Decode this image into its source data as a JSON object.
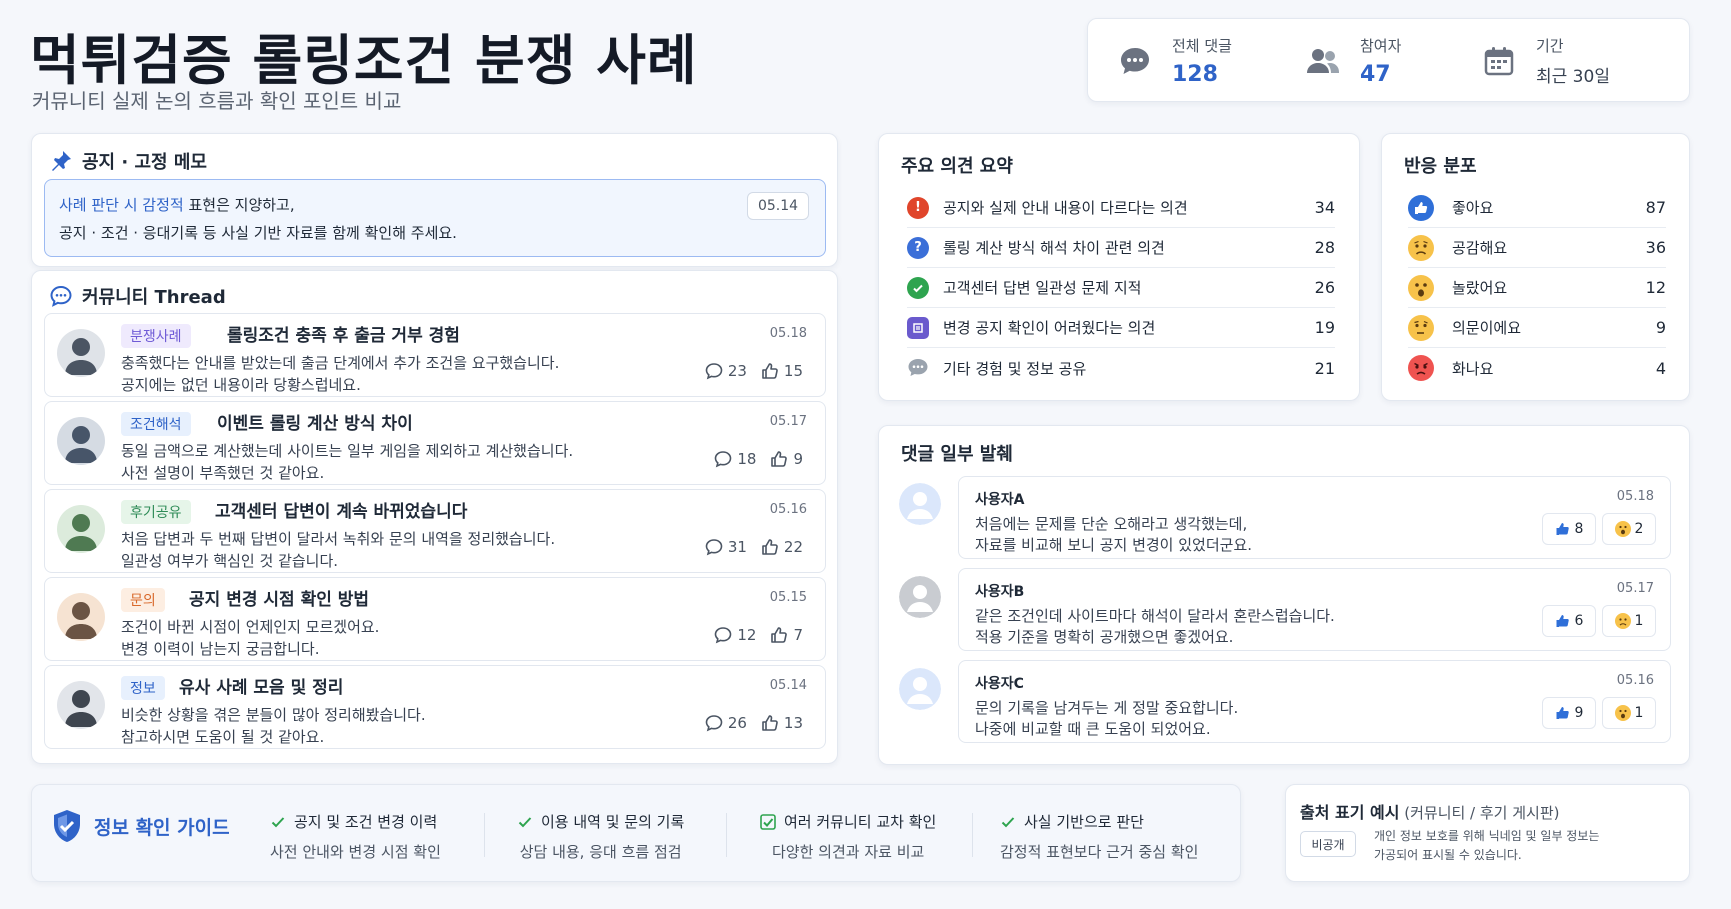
{
  "header": {
    "title": "먹튀검증 롤링조건 분쟁 사례",
    "subtitle": "커뮤니티 실제 논의 흐름과 확인 포인트 비교"
  },
  "stats": [
    {
      "label": "전체 댓글",
      "value": "128",
      "icon": "chat-bubble-icon"
    },
    {
      "label": "참여자",
      "value": "47",
      "icon": "users-icon"
    },
    {
      "label": "기간",
      "value": "최근 30일",
      "icon": "calendar-icon"
    }
  ],
  "notice": {
    "title": "공지 · 고정 메모",
    "line1_highlight": "사례 판단 시 감정적",
    "line1_rest": " 표현은 지양하고,",
    "line2": "공지 · 조건 · 응대기록 등 사실 기반 자료를 함께 확인해 주세요.",
    "date": "05.14"
  },
  "thread": {
    "title": "커뮤니티 Thread",
    "items": [
      {
        "tag": "분쟁사례",
        "title": "롤링조건 충족 후 출금 거부 경험",
        "date": "05.18",
        "line1": "충족했다는 안내를 받았는데 출금 단계에서 추가 조건을 요구했습니다.",
        "line2": "공지에는 없던 내용이라 당황스럽네요.",
        "comments": "23",
        "likes": "15"
      },
      {
        "tag": "조건해석",
        "title": "이벤트 롤링 계산 방식 차이",
        "date": "05.17",
        "line1": "동일 금액으로 계산했는데 사이트는 일부 게임을 제외하고 계산했습니다.",
        "line2": "사전 설명이 부족했던 것 같아요.",
        "comments": "18",
        "likes": "9"
      },
      {
        "tag": "후기공유",
        "title": "고객센터 답변이 계속 바뀌었습니다",
        "date": "05.16",
        "line1": "처음 답변과 두 번째 답변이 달라서 녹취와 문의 내역을 정리했습니다.",
        "line2": "일관성 여부가 핵심인 것 같습니다.",
        "comments": "31",
        "likes": "22"
      },
      {
        "tag": "문의",
        "title": "공지 변경 시점 확인 방법",
        "date": "05.15",
        "line1": "조건이 바뀐 시점이 언제인지 모르겠어요.",
        "line2": "변경 이력이 남는지 궁금합니다.",
        "comments": "12",
        "likes": "7"
      },
      {
        "tag": "정보",
        "title": "유사 사례 모음 및 정리",
        "date": "05.14",
        "line1": "비슷한 상황을 겪은 분들이 많아 정리해봤습니다.",
        "line2": "참고하시면 도움이 될 것 같아요.",
        "comments": "26",
        "likes": "13"
      }
    ]
  },
  "summary": {
    "title": "주요 의견 요약",
    "rows": [
      {
        "label": "공지와 실제 안내 내용이 다르다는 의견",
        "count": "34",
        "icon": "alert-icon",
        "color": "#e0452b"
      },
      {
        "label": "롤링 계산 방식 해석 차이 관련 의견",
        "count": "28",
        "icon": "question-icon",
        "color": "#3b6fd8"
      },
      {
        "label": "고객센터 답변 일관성 문제 지적",
        "count": "26",
        "icon": "check-icon",
        "color": "#2ea44f"
      },
      {
        "label": "변경 공지 확인이 어려웠다는 의견",
        "count": "19",
        "icon": "document-icon",
        "color": "#6a5acd"
      },
      {
        "label": "기타 경험 및 정보 공유",
        "count": "21",
        "icon": "chat-icon",
        "color": "#9aa3ae"
      }
    ]
  },
  "reactions": {
    "title": "반응 분포",
    "rows": [
      {
        "label": "좋아요",
        "count": "87",
        "icon": "thumbs-up-icon"
      },
      {
        "label": "공감해요",
        "count": "36",
        "icon": "sad-face-icon"
      },
      {
        "label": "놀랐어요",
        "count": "12",
        "icon": "surprised-face-icon"
      },
      {
        "label": "의문이에요",
        "count": "9",
        "icon": "thinking-face-icon"
      },
      {
        "label": "화나요",
        "count": "4",
        "icon": "angry-face-icon"
      }
    ]
  },
  "excerpts": {
    "title": "댓글 일부 발췌",
    "items": [
      {
        "name": "사용자A",
        "date": "05.18",
        "line1": "처음에는 문제를 단순 오해라고 생각했는데,",
        "line2": "자료를 비교해 보니 공지 변경이 있었더군요.",
        "likes": "8",
        "reaction": "2"
      },
      {
        "name": "사용자B",
        "date": "05.17",
        "line1": "같은 조건인데 사이트마다 해석이 달라서 혼란스럽습니다.",
        "line2": "적용 기준을 명확히 공개했으면 좋겠어요.",
        "likes": "6",
        "reaction": "1"
      },
      {
        "name": "사용자C",
        "date": "05.16",
        "line1": "문의 기록을 남겨두는 게 정말 중요합니다.",
        "line2": "나중에 비교할 때 큰 도움이 되었어요.",
        "likes": "9",
        "reaction": "1"
      }
    ]
  },
  "guide": {
    "title": "정보 확인 가이드",
    "items": [
      {
        "head": "공지 및 조건 변경 이력",
        "sub": "사전 안내와 변경 시점 확인"
      },
      {
        "head": "이용 내역 및 문의 기록",
        "sub": "상담 내용, 응대 흐름 점검"
      },
      {
        "head": "여러 커뮤니티 교차 확인",
        "sub": "다양한 의견과 자료 비교"
      },
      {
        "head": "사실 기반으로 판단",
        "sub": "감정적 표현보다 근거 중심 확인"
      }
    ]
  },
  "source": {
    "title": "출처 표기 예시",
    "title_sub": " (커뮤니티 / 후기 게시판)",
    "badge": "비공개",
    "desc1": "개인 정보 보호를 위해 닉네임 및 일부 정보는",
    "desc2": "가공되어 표시될 수 있습니다."
  },
  "colors": {
    "accent": "#2f63c8",
    "notice_bg": "#f1f6fe",
    "notice_border": "#9cbaf2"
  }
}
